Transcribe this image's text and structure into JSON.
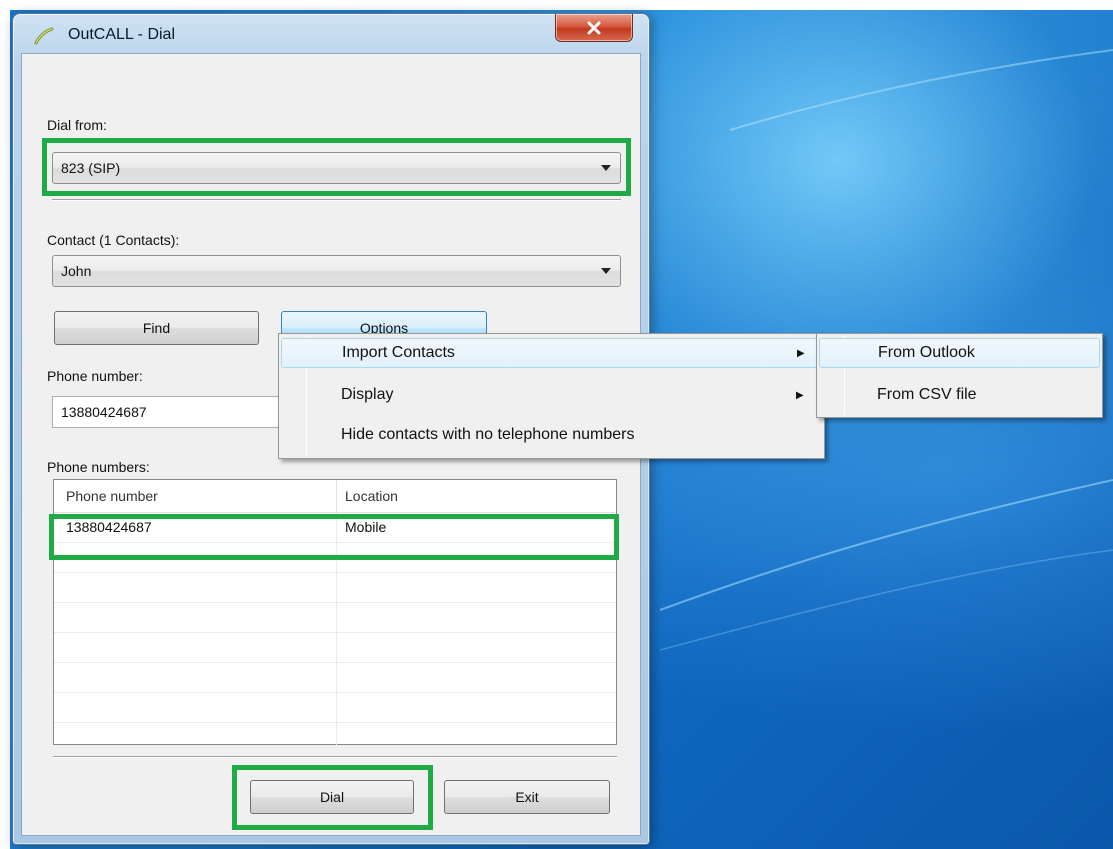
{
  "window": {
    "title": "OutCALL - Dial",
    "close_glyph": "X"
  },
  "dial_from": {
    "label": "Dial from:",
    "value": "823  (SIP)"
  },
  "contact": {
    "label": "Contact (1 Contacts):",
    "value": "John"
  },
  "buttons": {
    "find": "Find",
    "options": "Options",
    "dial": "Dial",
    "exit": "Exit"
  },
  "phone_number": {
    "label": "Phone number:",
    "value": "13880424687"
  },
  "phone_numbers": {
    "label": "Phone numbers:",
    "columns": [
      "Phone number",
      "Location"
    ],
    "rows": [
      [
        "13880424687",
        "Mobile"
      ]
    ]
  },
  "options_menu": {
    "items": [
      {
        "label": "Import Contacts",
        "has_submenu": true
      },
      {
        "label": "Display",
        "has_submenu": true
      },
      {
        "label": "Hide contacts with no telephone numbers",
        "has_submenu": false
      }
    ]
  },
  "import_submenu": {
    "items": [
      {
        "label": "From Outlook"
      },
      {
        "label": "From CSV file"
      }
    ]
  },
  "colors": {
    "highlight": "#1faa45",
    "desktop": "#1a78cc"
  }
}
